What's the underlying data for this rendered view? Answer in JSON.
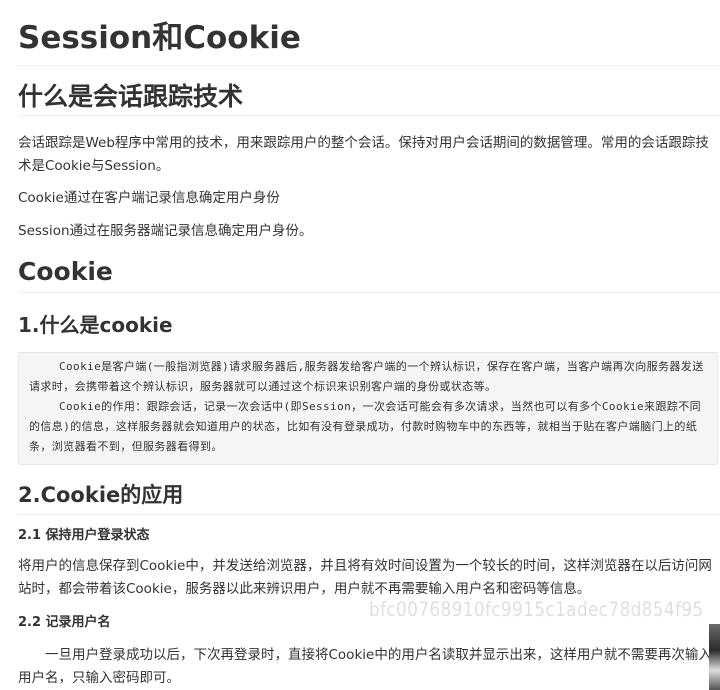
{
  "title": "Session和Cookie",
  "intro": {
    "heading": "什么是会话跟踪技术",
    "paragraphs": [
      "会话跟踪是Web程序中常用的技术，用来跟踪用户的整个会话。保持对用户会话期间的数据管理。常用的会话跟踪技术是Cookie与Session。",
      "Cookie通过在客户端记录信息确定用户身份",
      "Session通过在服务器端记录信息确定用户身份。"
    ]
  },
  "cookie": {
    "heading": "Cookie",
    "what": {
      "heading": "1.什么是cookie",
      "code_paragraphs": [
        "Cookie是客户端(一般指浏览器)请求服务器后,服务器发给客户端的一个辨认标识，保存在客户端，当客户端再次向服务器发送请求时，会携带着这个辨认标识，服务器就可以通过这个标识来识别客户端的身份或状态等。",
        "Cookie的作用：跟踪会话，记录一次会话中(即Session，一次会话可能会有多次请求，当然也可以有多个Cookie来跟踪不同的信息)的信息，这样服务器就会知道用户的状态，比如有没有登录成功，付款时购物车中的东西等，就相当于贴在客户端脑门上的纸条，浏览器看不到，但服务器看得到。"
      ]
    },
    "apply": {
      "heading": "2.Cookie的应用",
      "sub1": {
        "heading": "2.1 保持用户登录状态",
        "text": "将用户的信息保存到Cookie中，并发送给浏览器，并且将有效时间设置为一个较长的时间，这样浏览器在以后访问网站时，都会带着该Cookie，服务器以此来辨识用户，用户就不再需要输入用户名和密码等信息。"
      },
      "sub2": {
        "heading": "2.2  记录用户名",
        "text": "一旦用户登录成功以后，下次再登录时，直接将Cookie中的用户名读取并显示出来，这样用户就不需要再次输入用户名，只输入密码即可。"
      }
    }
  },
  "watermark": "bfc00768910fc9915c1adec78d854f95"
}
